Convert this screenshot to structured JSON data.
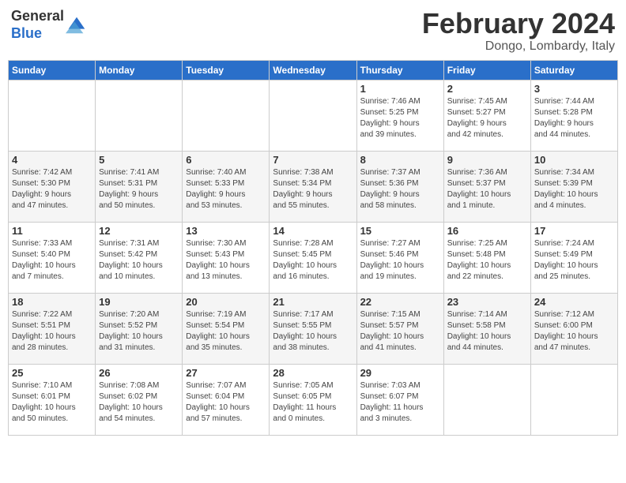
{
  "header": {
    "logo_general": "General",
    "logo_blue": "Blue",
    "month_title": "February 2024",
    "location": "Dongo, Lombardy, Italy"
  },
  "calendar": {
    "weekdays": [
      "Sunday",
      "Monday",
      "Tuesday",
      "Wednesday",
      "Thursday",
      "Friday",
      "Saturday"
    ],
    "rows": [
      [
        {
          "day": "",
          "info": ""
        },
        {
          "day": "",
          "info": ""
        },
        {
          "day": "",
          "info": ""
        },
        {
          "day": "",
          "info": ""
        },
        {
          "day": "1",
          "info": "Sunrise: 7:46 AM\nSunset: 5:25 PM\nDaylight: 9 hours\nand 39 minutes."
        },
        {
          "day": "2",
          "info": "Sunrise: 7:45 AM\nSunset: 5:27 PM\nDaylight: 9 hours\nand 42 minutes."
        },
        {
          "day": "3",
          "info": "Sunrise: 7:44 AM\nSunset: 5:28 PM\nDaylight: 9 hours\nand 44 minutes."
        }
      ],
      [
        {
          "day": "4",
          "info": "Sunrise: 7:42 AM\nSunset: 5:30 PM\nDaylight: 9 hours\nand 47 minutes."
        },
        {
          "day": "5",
          "info": "Sunrise: 7:41 AM\nSunset: 5:31 PM\nDaylight: 9 hours\nand 50 minutes."
        },
        {
          "day": "6",
          "info": "Sunrise: 7:40 AM\nSunset: 5:33 PM\nDaylight: 9 hours\nand 53 minutes."
        },
        {
          "day": "7",
          "info": "Sunrise: 7:38 AM\nSunset: 5:34 PM\nDaylight: 9 hours\nand 55 minutes."
        },
        {
          "day": "8",
          "info": "Sunrise: 7:37 AM\nSunset: 5:36 PM\nDaylight: 9 hours\nand 58 minutes."
        },
        {
          "day": "9",
          "info": "Sunrise: 7:36 AM\nSunset: 5:37 PM\nDaylight: 10 hours\nand 1 minute."
        },
        {
          "day": "10",
          "info": "Sunrise: 7:34 AM\nSunset: 5:39 PM\nDaylight: 10 hours\nand 4 minutes."
        }
      ],
      [
        {
          "day": "11",
          "info": "Sunrise: 7:33 AM\nSunset: 5:40 PM\nDaylight: 10 hours\nand 7 minutes."
        },
        {
          "day": "12",
          "info": "Sunrise: 7:31 AM\nSunset: 5:42 PM\nDaylight: 10 hours\nand 10 minutes."
        },
        {
          "day": "13",
          "info": "Sunrise: 7:30 AM\nSunset: 5:43 PM\nDaylight: 10 hours\nand 13 minutes."
        },
        {
          "day": "14",
          "info": "Sunrise: 7:28 AM\nSunset: 5:45 PM\nDaylight: 10 hours\nand 16 minutes."
        },
        {
          "day": "15",
          "info": "Sunrise: 7:27 AM\nSunset: 5:46 PM\nDaylight: 10 hours\nand 19 minutes."
        },
        {
          "day": "16",
          "info": "Sunrise: 7:25 AM\nSunset: 5:48 PM\nDaylight: 10 hours\nand 22 minutes."
        },
        {
          "day": "17",
          "info": "Sunrise: 7:24 AM\nSunset: 5:49 PM\nDaylight: 10 hours\nand 25 minutes."
        }
      ],
      [
        {
          "day": "18",
          "info": "Sunrise: 7:22 AM\nSunset: 5:51 PM\nDaylight: 10 hours\nand 28 minutes."
        },
        {
          "day": "19",
          "info": "Sunrise: 7:20 AM\nSunset: 5:52 PM\nDaylight: 10 hours\nand 31 minutes."
        },
        {
          "day": "20",
          "info": "Sunrise: 7:19 AM\nSunset: 5:54 PM\nDaylight: 10 hours\nand 35 minutes."
        },
        {
          "day": "21",
          "info": "Sunrise: 7:17 AM\nSunset: 5:55 PM\nDaylight: 10 hours\nand 38 minutes."
        },
        {
          "day": "22",
          "info": "Sunrise: 7:15 AM\nSunset: 5:57 PM\nDaylight: 10 hours\nand 41 minutes."
        },
        {
          "day": "23",
          "info": "Sunrise: 7:14 AM\nSunset: 5:58 PM\nDaylight: 10 hours\nand 44 minutes."
        },
        {
          "day": "24",
          "info": "Sunrise: 7:12 AM\nSunset: 6:00 PM\nDaylight: 10 hours\nand 47 minutes."
        }
      ],
      [
        {
          "day": "25",
          "info": "Sunrise: 7:10 AM\nSunset: 6:01 PM\nDaylight: 10 hours\nand 50 minutes."
        },
        {
          "day": "26",
          "info": "Sunrise: 7:08 AM\nSunset: 6:02 PM\nDaylight: 10 hours\nand 54 minutes."
        },
        {
          "day": "27",
          "info": "Sunrise: 7:07 AM\nSunset: 6:04 PM\nDaylight: 10 hours\nand 57 minutes."
        },
        {
          "day": "28",
          "info": "Sunrise: 7:05 AM\nSunset: 6:05 PM\nDaylight: 11 hours\nand 0 minutes."
        },
        {
          "day": "29",
          "info": "Sunrise: 7:03 AM\nSunset: 6:07 PM\nDaylight: 11 hours\nand 3 minutes."
        },
        {
          "day": "",
          "info": ""
        },
        {
          "day": "",
          "info": ""
        }
      ]
    ]
  }
}
